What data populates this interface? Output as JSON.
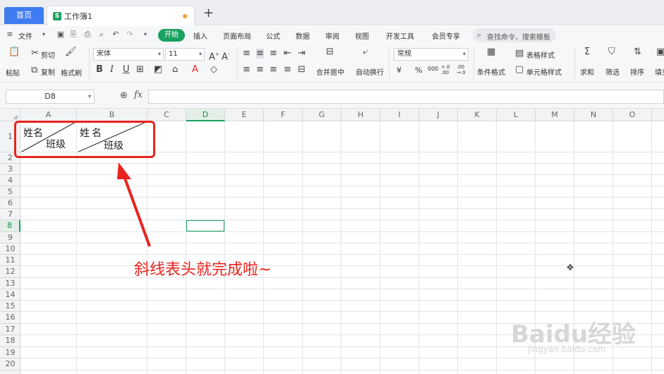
{
  "tabs": {
    "home": "首页",
    "document": "工作簿1",
    "new_tab": "+"
  },
  "menu": {
    "file": "文件",
    "items": [
      "开始",
      "插入",
      "页面布局",
      "公式",
      "数据",
      "审阅",
      "视图",
      "开发工具",
      "会员专享"
    ],
    "search": "查找命令、搜索模板"
  },
  "ribbon": {
    "paste": "粘贴",
    "cut": "剪切",
    "copy": "复制",
    "format_painter": "格式刷",
    "font_name": "宋体",
    "font_size": "11",
    "bold": "B",
    "italic": "I",
    "underline": "U",
    "merge_center": "合并居中",
    "wrap_text": "自动换行",
    "number_format": "常规",
    "currency": "¥",
    "percent": "%",
    "thousands": "000",
    "increase_decimal": "+.0 .00",
    "decrease_decimal": ".00 →.0",
    "conditional_format": "条件格式",
    "table_style": "表格样式",
    "cell_style": "单元格样式",
    "sum": "求和",
    "filter": "筛选",
    "sort": "排序",
    "fill": "填充"
  },
  "formula_bar": {
    "cell_ref": "D8",
    "fx": "fx",
    "value": ""
  },
  "columns": [
    "A",
    "B",
    "C",
    "D",
    "E",
    "F",
    "G",
    "H",
    "I",
    "J",
    "K",
    "L",
    "M",
    "N",
    "O"
  ],
  "active_column": "D",
  "rows": [
    "1",
    "2",
    "3",
    "4",
    "5",
    "6",
    "7",
    "8",
    "9",
    "10",
    "11",
    "12",
    "13",
    "14",
    "15",
    "16",
    "17",
    "18",
    "19",
    "20"
  ],
  "active_row": "8",
  "cells": {
    "A1": {
      "top": "姓名",
      "bottom": "班级"
    },
    "B1": {
      "top": "姓名",
      "bottom": "班级"
    }
  },
  "annotation": "斜线表头就完成啦~",
  "watermark": {
    "brand": "Baidu经验",
    "url": "jingyan.baidu.com"
  },
  "colors": {
    "accent": "#1aa260",
    "home_tab": "#3f7cf2",
    "annotation": "#e8241e"
  }
}
